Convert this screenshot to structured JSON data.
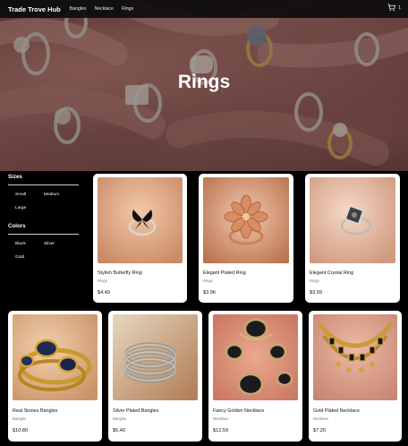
{
  "nav": {
    "brand": "Trade Trove Hub",
    "links": [
      "Bangles",
      "Necklace",
      "Rings"
    ],
    "cart_count": "1"
  },
  "hero": {
    "title": "Rings"
  },
  "filters": {
    "sizes_title": "Sizes",
    "sizes": [
      "Small",
      "Medium",
      "Large"
    ],
    "colors_title": "Colors",
    "colors": [
      "Black",
      "Silver",
      "Gold"
    ]
  },
  "products": [
    {
      "name": "Stylish Butterfly Ring",
      "category": "Rings",
      "price": "$4.49",
      "image": "butterfly-ring"
    },
    {
      "name": "Elegant Plated Ring",
      "category": "Rings",
      "price": "$3.96",
      "image": "plated-ring"
    },
    {
      "name": "Elegant Crystal Ring",
      "category": "Rings",
      "price": "$3.59",
      "image": "crystal-ring"
    },
    {
      "name": "Real Stones Bangles",
      "category": "Bangles",
      "price": "$10.80",
      "image": "stone-bangles"
    },
    {
      "name": "Silver Plated Bangles",
      "category": "Bangles",
      "price": "$5.40",
      "image": "silver-bangles"
    },
    {
      "name": "Fancy Golden Necklace",
      "category": "Necklace",
      "price": "$12.59",
      "image": "golden-necklace"
    },
    {
      "name": "Gold Plated Necklace",
      "category": "Necklace",
      "price": "$7.20",
      "image": "gold-necklace"
    }
  ],
  "colors": {
    "page_bg": "#000000",
    "card_bg": "#ffffff",
    "nav_bg": "#0c0c0c"
  }
}
